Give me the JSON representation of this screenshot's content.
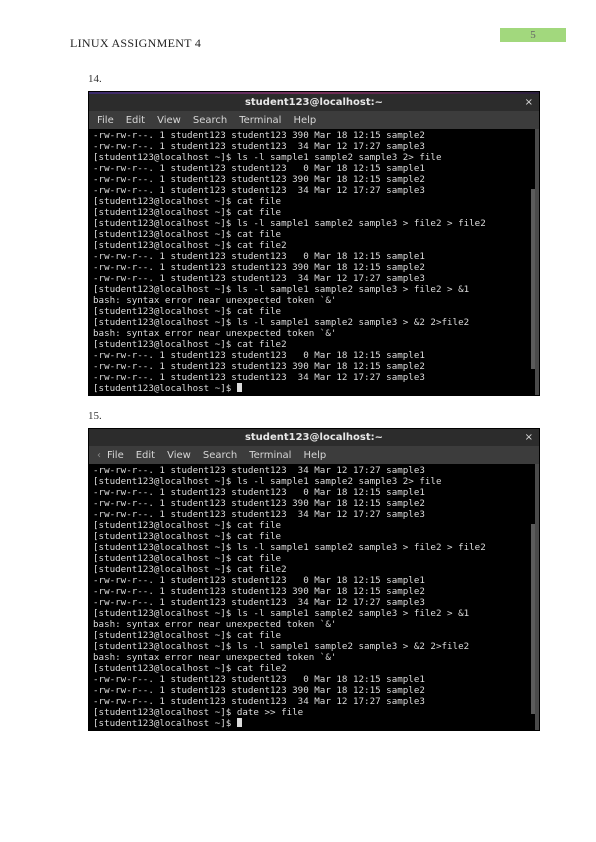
{
  "header": {
    "title": "LINUX ASSIGNMENT 4",
    "page_number": "5"
  },
  "item14": {
    "number": "14.",
    "terminal_title": "student123@localhost:~",
    "close_label": "×",
    "menu": [
      "File",
      "Edit",
      "View",
      "Search",
      "Terminal",
      "Help"
    ],
    "lines": [
      "-rw-rw-r--. 1 student123 student123 390 Mar 18 12:15 sample2",
      "-rw-rw-r--. 1 student123 student123  34 Mar 12 17:27 sample3",
      "[student123@localhost ~]$ ls -l sample1 sample2 sample3 2> file",
      "-rw-rw-r--. 1 student123 student123   0 Mar 18 12:15 sample1",
      "-rw-rw-r--. 1 student123 student123 390 Mar 18 12:15 sample2",
      "-rw-rw-r--. 1 student123 student123  34 Mar 12 17:27 sample3",
      "[student123@localhost ~]$ cat file",
      "[student123@localhost ~]$ cat file",
      "[student123@localhost ~]$ ls -l sample1 sample2 sample3 > file2 > file2",
      "[student123@localhost ~]$ cat file",
      "[student123@localhost ~]$ cat file2",
      "-rw-rw-r--. 1 student123 student123   0 Mar 18 12:15 sample1",
      "-rw-rw-r--. 1 student123 student123 390 Mar 18 12:15 sample2",
      "-rw-rw-r--. 1 student123 student123  34 Mar 12 17:27 sample3",
      "[student123@localhost ~]$ ls -l sample1 sample2 sample3 > file2 > &1",
      "bash: syntax error near unexpected token `&'",
      "[student123@localhost ~]$ cat file",
      "[student123@localhost ~]$ ls -l sample1 sample2 sample3 > &2 2>file2",
      "bash: syntax error near unexpected token `&'",
      "[student123@localhost ~]$ cat file2",
      "-rw-rw-r--. 1 student123 student123   0 Mar 18 12:15 sample1",
      "-rw-rw-r--. 1 student123 student123 390 Mar 18 12:15 sample2",
      "-rw-rw-r--. 1 student123 student123  34 Mar 12 17:27 sample3",
      "[student123@localhost ~]$ "
    ]
  },
  "item15": {
    "number": "15.",
    "terminal_title": "student123@localhost:~",
    "close_label": "×",
    "menu": [
      "File",
      "Edit",
      "View",
      "Search",
      "Terminal",
      "Help"
    ],
    "lines": [
      "-rw-rw-r--. 1 student123 student123  34 Mar 12 17:27 sample3",
      "[student123@localhost ~]$ ls -l sample1 sample2 sample3 2> file",
      "-rw-rw-r--. 1 student123 student123   0 Mar 18 12:15 sample1",
      "-rw-rw-r--. 1 student123 student123 390 Mar 18 12:15 sample2",
      "-rw-rw-r--. 1 student123 student123  34 Mar 12 17:27 sample3",
      "[student123@localhost ~]$ cat file",
      "[student123@localhost ~]$ cat file",
      "[student123@localhost ~]$ ls -l sample1 sample2 sample3 > file2 > file2",
      "[student123@localhost ~]$ cat file",
      "[student123@localhost ~]$ cat file2",
      "-rw-rw-r--. 1 student123 student123   0 Mar 18 12:15 sample1",
      "-rw-rw-r--. 1 student123 student123 390 Mar 18 12:15 sample2",
      "-rw-rw-r--. 1 student123 student123  34 Mar 12 17:27 sample3",
      "[student123@localhost ~]$ ls -l sample1 sample2 sample3 > file2 > &1",
      "bash: syntax error near unexpected token `&'",
      "[student123@localhost ~]$ cat file",
      "[student123@localhost ~]$ ls -l sample1 sample2 sample3 > &2 2>file2",
      "bash: syntax error near unexpected token `&'",
      "[student123@localhost ~]$ cat file2",
      "-rw-rw-r--. 1 student123 student123   0 Mar 18 12:15 sample1",
      "-rw-rw-r--. 1 student123 student123 390 Mar 18 12:15 sample2",
      "-rw-rw-r--. 1 student123 student123  34 Mar 12 17:27 sample3",
      "[student123@localhost ~]$ date >> file",
      "[student123@localhost ~]$ "
    ]
  }
}
